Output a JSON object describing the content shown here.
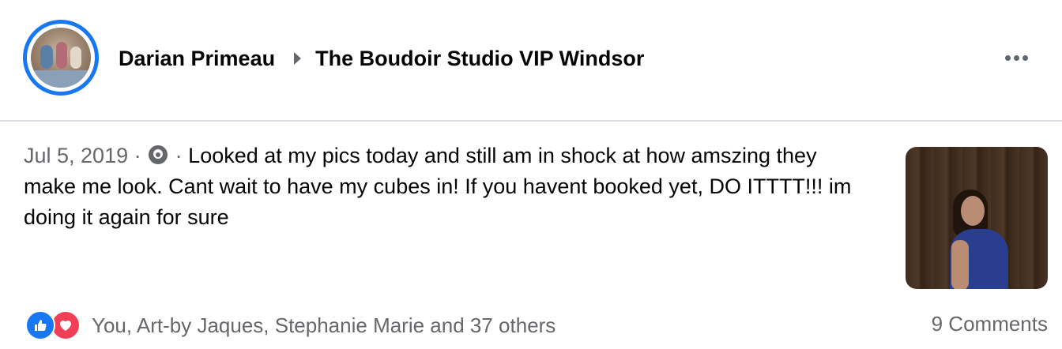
{
  "post": {
    "author": "Darian Primeau",
    "group": "The Boudoir Studio VIP Windsor",
    "date": "Jul 5, 2019",
    "separator": "·",
    "text": "Looked at my pics today and still am in shock at how amszing they make me look. Cant wait to have my cubes in! If you havent booked yet, DO ITTTT!!! im doing it again for sure",
    "audience_icon": "group-icon"
  },
  "engagement": {
    "reaction_icons": [
      "like-icon",
      "love-icon"
    ],
    "reactors": "You, Art-by Jaques, Stephanie Marie and 37 others",
    "comments": "9 Comments"
  },
  "colors": {
    "accent": "#1877f2",
    "love": "#f33e58",
    "secondary_text": "#65676b",
    "divider": "#dadde1"
  }
}
